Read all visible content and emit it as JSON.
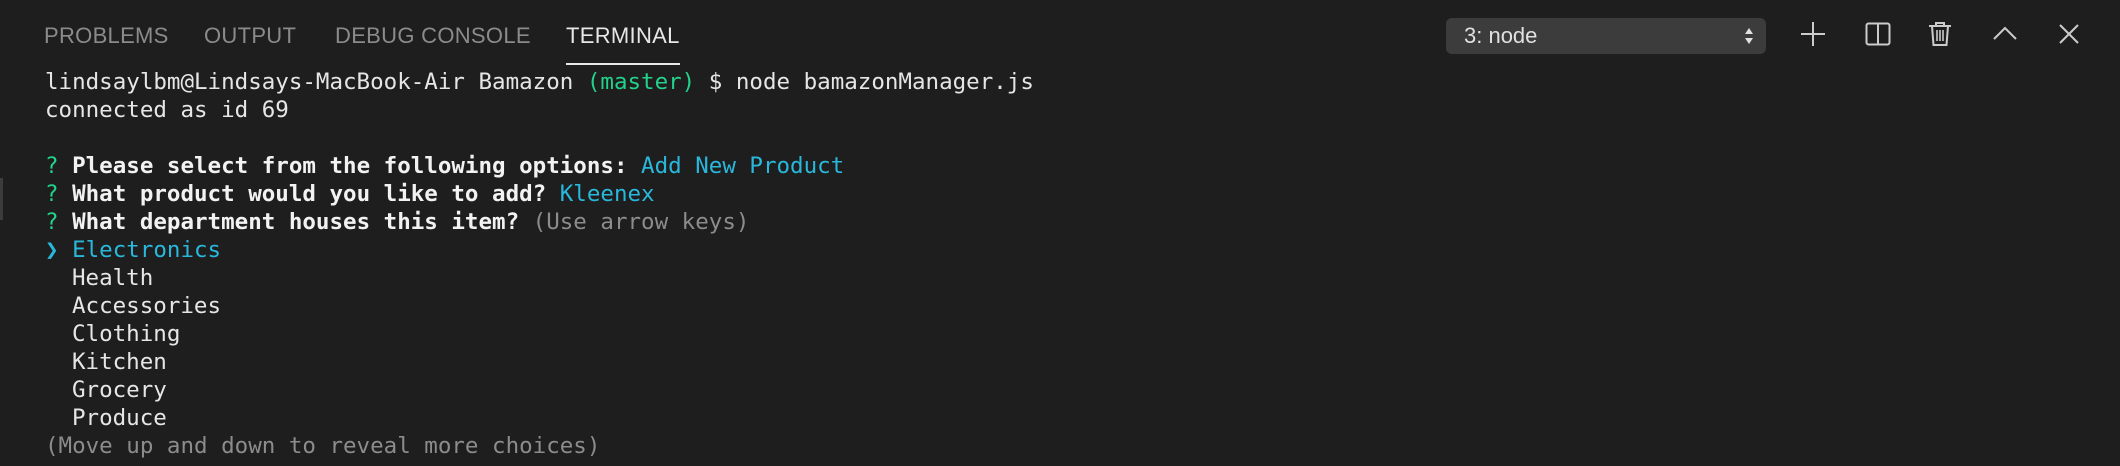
{
  "tabs": [
    {
      "label": "PROBLEMS"
    },
    {
      "label": "OUTPUT"
    },
    {
      "label": "DEBUG CONSOLE"
    },
    {
      "label": "TERMINAL",
      "active": true
    }
  ],
  "terminal_select": {
    "value": "3: node"
  },
  "icons": {
    "new_terminal": "plus-icon",
    "split": "split-icon",
    "kill": "trash-icon",
    "maximize": "chevron-up-icon",
    "close": "close-icon"
  },
  "colors": {
    "background": "#1e1e1e",
    "foreground": "#e6e6e6",
    "green": "#23d18b",
    "cyan": "#29b8db",
    "dim": "#8c8c8c"
  },
  "terminal": {
    "prompt_user": "lindsaylbm@Lindsays-MacBook-Air Bamazon",
    "prompt_branch": "(master)",
    "prompt_symbol": "$",
    "command": "node bamazonManager.js",
    "connected": "connected as id 69",
    "q1": {
      "mark": "?",
      "question": "Please select from the following options:",
      "answer": "Add New Product"
    },
    "q2": {
      "mark": "?",
      "question": "What product would you like to add?",
      "answer": "Kleenex"
    },
    "q3": {
      "mark": "?",
      "question": "What department houses this item?",
      "hint": "(Use arrow keys)"
    },
    "pointer": "❯",
    "selected_choice": "Electronics",
    "choices": [
      "Health",
      "Accessories",
      "Clothing",
      "Kitchen",
      "Grocery",
      "Produce"
    ],
    "footer_hint": "(Move up and down to reveal more choices)"
  }
}
